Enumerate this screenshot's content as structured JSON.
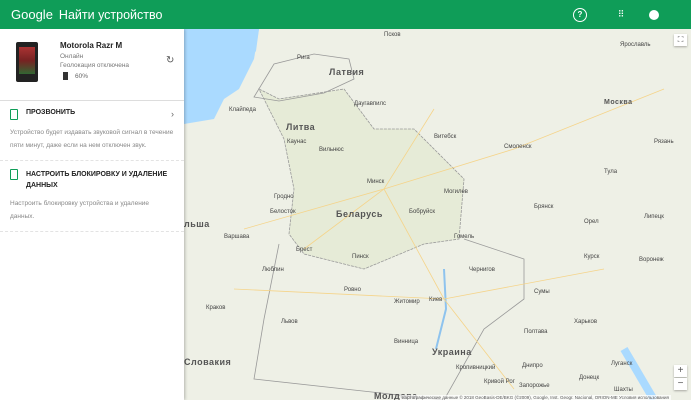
{
  "header": {
    "logo": "Google",
    "title": "Найти устройство",
    "icons": [
      "help-icon",
      "apps-icon",
      "account-icon"
    ]
  },
  "device": {
    "name": "Motorola Razr M",
    "status": "Онлайн",
    "location": "Геолокация отключена",
    "battery": "60%"
  },
  "actions": [
    {
      "label": "ПРОЗВОНИТЬ",
      "desc": "Устройство будет издавать звуковой сигнал в течение пяти минут, даже если на нем отключен звук."
    },
    {
      "label": "НАСТРОИТЬ БЛОКИРОВКУ И УДАЛЕНИЕ ДАННЫХ",
      "desc": "Настроить блокировку устройства и удаление данных."
    }
  ],
  "map": {
    "countries": {
      "latvia": "Латвия",
      "lithuania": "Литва",
      "belarus": "Беларусь",
      "ukraine": "Украина",
      "poland": "льша",
      "slovakia": "Словакия",
      "moldova": "Молдова"
    },
    "cities": {
      "riga": "Рига",
      "klaipeda": "Клайпеда",
      "kaunas": "Каунас",
      "vilnius": "Вильнюс",
      "minsk": "Минск",
      "brest": "Брест",
      "grodno": "Гродно",
      "bialystok": "Белосток",
      "warsaw": "Варшава",
      "lublin": "Люблин",
      "lviv": "Львов",
      "krakow": "Краков",
      "kyiv": "Киев",
      "vitebsk": "Витебск",
      "mogilev": "Могилев",
      "gomel": "Гомель",
      "bobruisk": "Бобруйск",
      "smolensk": "Смоленск",
      "bryansk": "Брянск",
      "kursk": "Курск",
      "kharkiv": "Харьков",
      "voronezh": "Воронеж",
      "dnipro": "Днипро",
      "kryvyi_rih": "Кривой Рог",
      "zaporizhzhia": "Запорожье",
      "donetsk": "Донецк",
      "luhansk": "Луганск",
      "kropyvnytskyi": "Кропивницкий",
      "shakhty": "Шахты",
      "yaroslavl": "Ярославль",
      "moscow": "Москва",
      "tula": "Тула",
      "pskov": "Псков",
      "daugavpils": "Даугавпилс",
      "pinsk": "Пинск",
      "rivne": "Ровно",
      "zhytomyr": "Житомир",
      "vinnytsia": "Винница",
      "chernihiv": "Чернигов",
      "sumy": "Сумы",
      "poltava": "Полтава",
      "orel": "Орел",
      "lipetsk": "Липецк",
      "ryazan": "Рязань"
    },
    "attribution": "Картографические данные © 2018 GeoBasis-DE/BKG (©2009), Google, Inst. Geogr. Nacional, ORION-ME   Условия использования",
    "zoom_in": "+",
    "zoom_out": "−"
  }
}
